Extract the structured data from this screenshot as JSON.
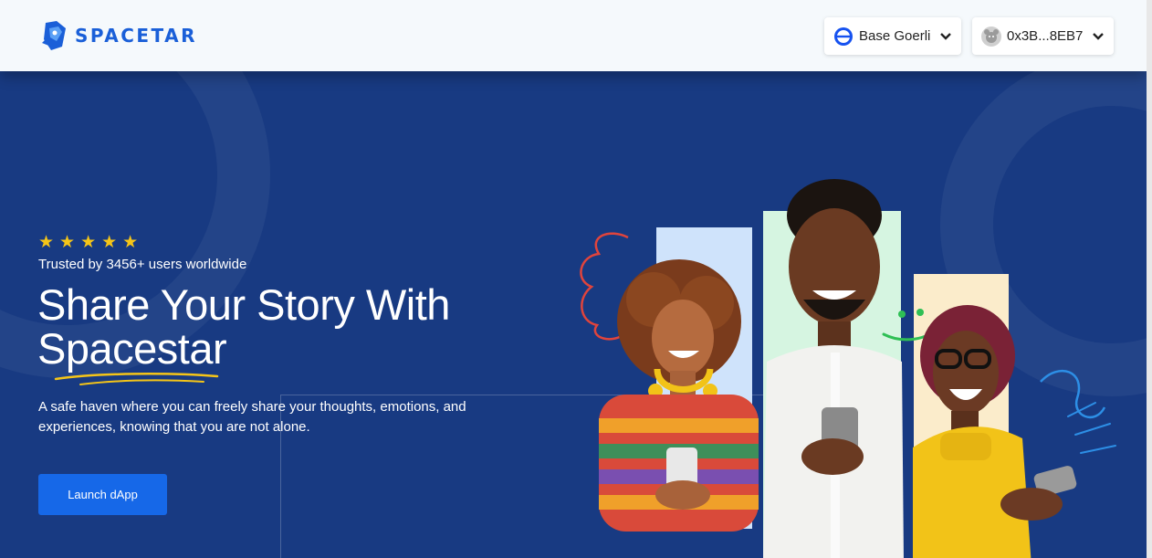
{
  "header": {
    "logo_text": "SPACETAR",
    "network": {
      "label": "Base Goerli",
      "icon": "base-network-icon"
    },
    "wallet": {
      "label": "0x3B...8EB7",
      "icon": "avatar-icon"
    }
  },
  "hero": {
    "stars": "★★★★★",
    "rating": 5,
    "trusted_text": "Trusted by 3456+ users worldwide",
    "headline_line1": "Share Your Story With",
    "headline_line2": "Spacestar",
    "description": "A safe haven where you can freely share your thoughts, emotions, and experiences, knowing that you are not alone.",
    "cta_label": "Launch dApp"
  },
  "colors": {
    "header_bg": "#f5f9fc",
    "hero_bg": "#183a82",
    "accent_blue": "#1668e8",
    "logo_blue": "#1a5fd8",
    "star_yellow": "#f5c518",
    "panel_blue": "#cfe3fb",
    "panel_green": "#d6f5e1",
    "panel_yellow": "#fbeccb"
  }
}
